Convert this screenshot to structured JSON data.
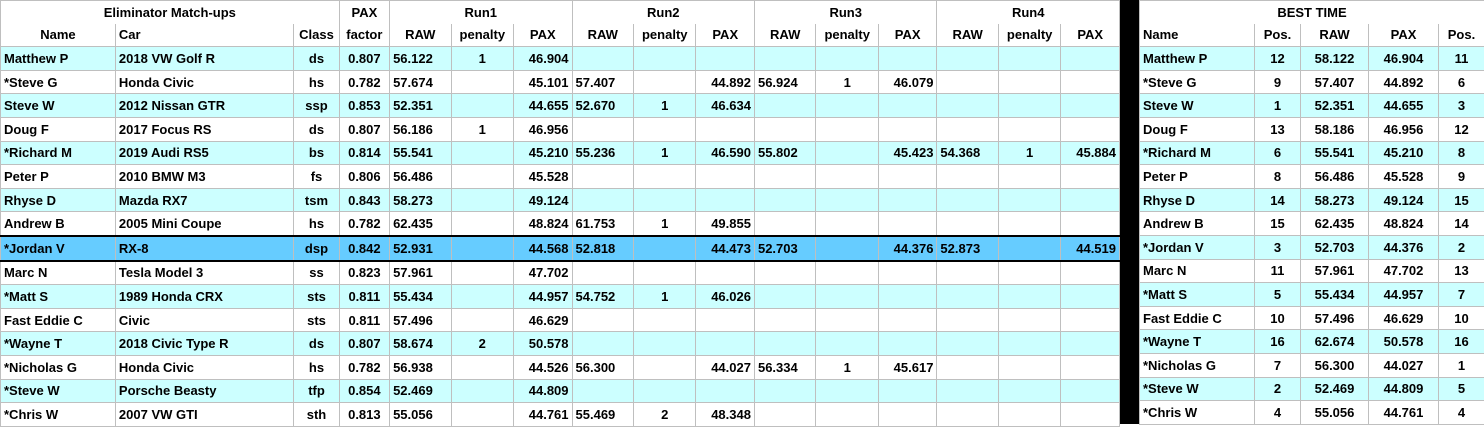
{
  "left": {
    "group_title": "Eliminator Match-ups",
    "pax_header": "PAX",
    "run_titles": [
      "Run1",
      "Run2",
      "Run3",
      "Run4"
    ],
    "col_headers": {
      "name": "Name",
      "car": "Car",
      "class": "Class",
      "factor": "factor",
      "raw": "RAW",
      "penalty": "penalty",
      "pax": "PAX"
    },
    "rows": [
      {
        "name": "Matthew P",
        "car": "2018 VW Golf R",
        "class": "ds",
        "factor": "0.807",
        "runs": [
          [
            "56.122",
            "1",
            "46.904"
          ],
          [
            "",
            "",
            ""
          ],
          [
            "",
            "",
            ""
          ],
          [
            "",
            "",
            ""
          ]
        ]
      },
      {
        "name": "*Steve G",
        "car": "Honda Civic",
        "class": "hs",
        "factor": "0.782",
        "runs": [
          [
            "57.674",
            "",
            "45.101"
          ],
          [
            "57.407",
            "",
            "44.892"
          ],
          [
            "56.924",
            "1",
            "46.079"
          ],
          [
            "",
            "",
            ""
          ]
        ]
      },
      {
        "name": "Steve W",
        "car": "2012 Nissan GTR",
        "class": "ssp",
        "factor": "0.853",
        "runs": [
          [
            "52.351",
            "",
            "44.655"
          ],
          [
            "52.670",
            "1",
            "46.634"
          ],
          [
            "",
            "",
            ""
          ],
          [
            "",
            "",
            ""
          ]
        ]
      },
      {
        "name": "Doug  F",
        "car": "2017 Focus RS",
        "class": "ds",
        "factor": "0.807",
        "runs": [
          [
            "56.186",
            "1",
            "46.956"
          ],
          [
            "",
            "",
            ""
          ],
          [
            "",
            "",
            ""
          ],
          [
            "",
            "",
            ""
          ]
        ]
      },
      {
        "name": "*Richard M",
        "car": "2019 Audi RS5",
        "class": "bs",
        "factor": "0.814",
        "runs": [
          [
            "55.541",
            "",
            "45.210"
          ],
          [
            "55.236",
            "1",
            "46.590"
          ],
          [
            "55.802",
            "",
            "45.423"
          ],
          [
            "54.368",
            "1",
            "45.884"
          ]
        ]
      },
      {
        "name": "Peter P",
        "car": "2010 BMW M3",
        "class": "fs",
        "factor": "0.806",
        "runs": [
          [
            "56.486",
            "",
            "45.528"
          ],
          [
            "",
            "",
            ""
          ],
          [
            "",
            "",
            ""
          ],
          [
            "",
            "",
            ""
          ]
        ]
      },
      {
        "name": "Rhyse D",
        "car": "Mazda RX7",
        "class": "tsm",
        "factor": "0.843",
        "runs": [
          [
            "58.273",
            "",
            "49.124"
          ],
          [
            "",
            "",
            ""
          ],
          [
            "",
            "",
            ""
          ],
          [
            "",
            "",
            ""
          ]
        ]
      },
      {
        "name": "Andrew B",
        "car": "2005 Mini Coupe",
        "class": "hs",
        "factor": "0.782",
        "runs": [
          [
            "62.435",
            "",
            "48.824"
          ],
          [
            "61.753",
            "1",
            "49.855"
          ],
          [
            "",
            "",
            ""
          ],
          [
            "",
            "",
            ""
          ]
        ]
      },
      {
        "name": "*Jordan V",
        "car": "RX-8",
        "class": "dsp",
        "factor": "0.842",
        "runs": [
          [
            "52.931",
            "",
            "44.568"
          ],
          [
            "52.818",
            "",
            "44.473"
          ],
          [
            "52.703",
            "",
            "44.376"
          ],
          [
            "52.873",
            "",
            "44.519"
          ]
        ]
      },
      {
        "name": "Marc N",
        "car": "Tesla Model 3",
        "class": "ss",
        "factor": "0.823",
        "runs": [
          [
            "57.961",
            "",
            "47.702"
          ],
          [
            "",
            "",
            ""
          ],
          [
            "",
            "",
            ""
          ],
          [
            "",
            "",
            ""
          ]
        ]
      },
      {
        "name": "*Matt S",
        "car": "1989 Honda CRX",
        "class": "sts",
        "factor": "0.811",
        "runs": [
          [
            "55.434",
            "",
            "44.957"
          ],
          [
            "54.752",
            "1",
            "46.026"
          ],
          [
            "",
            "",
            ""
          ],
          [
            "",
            "",
            ""
          ]
        ]
      },
      {
        "name": "Fast Eddie C",
        "car": "Civic",
        "class": "sts",
        "factor": "0.811",
        "runs": [
          [
            "57.496",
            "",
            "46.629"
          ],
          [
            "",
            "",
            ""
          ],
          [
            "",
            "",
            ""
          ],
          [
            "",
            "",
            ""
          ]
        ]
      },
      {
        "name": "*Wayne T",
        "car": "2018 Civic Type R",
        "class": "ds",
        "factor": "0.807",
        "runs": [
          [
            "58.674",
            "2",
            "50.578"
          ],
          [
            "",
            "",
            ""
          ],
          [
            "",
            "",
            ""
          ],
          [
            "",
            "",
            ""
          ]
        ]
      },
      {
        "name": "*Nicholas G",
        "car": "Honda Civic",
        "class": "hs",
        "factor": "0.782",
        "runs": [
          [
            "56.938",
            "",
            "44.526"
          ],
          [
            "56.300",
            "",
            "44.027"
          ],
          [
            "56.334",
            "1",
            "45.617"
          ],
          [
            "",
            "",
            ""
          ]
        ]
      },
      {
        "name": "*Steve W",
        "car": "Porsche Beasty",
        "class": "tfp",
        "factor": "0.854",
        "runs": [
          [
            "52.469",
            "",
            "44.809"
          ],
          [
            "",
            "",
            ""
          ],
          [
            "",
            "",
            ""
          ],
          [
            "",
            "",
            ""
          ]
        ]
      },
      {
        "name": "*Chris W",
        "car": "2007 VW GTI",
        "class": "sth",
        "factor": "0.813",
        "runs": [
          [
            "55.056",
            "",
            "44.761"
          ],
          [
            "55.469",
            "2",
            "48.348"
          ],
          [
            "",
            "",
            ""
          ],
          [
            "",
            "",
            ""
          ]
        ]
      }
    ]
  },
  "right": {
    "title": "BEST TIME",
    "col_headers": {
      "name": "Name",
      "pos1": "Pos.",
      "raw": "RAW",
      "pax": "PAX",
      "pos2": "Pos."
    },
    "rows": [
      {
        "name": "Matthew P",
        "pos1": "12",
        "raw": "58.122",
        "pax": "46.904",
        "pos2": "11"
      },
      {
        "name": "*Steve G",
        "pos1": "9",
        "raw": "57.407",
        "pax": "44.892",
        "pos2": "6"
      },
      {
        "name": "Steve W",
        "pos1": "1",
        "raw": "52.351",
        "pax": "44.655",
        "pos2": "3"
      },
      {
        "name": "Doug  F",
        "pos1": "13",
        "raw": "58.186",
        "pax": "46.956",
        "pos2": "12"
      },
      {
        "name": "*Richard M",
        "pos1": "6",
        "raw": "55.541",
        "pax": "45.210",
        "pos2": "8"
      },
      {
        "name": "Peter P",
        "pos1": "8",
        "raw": "56.486",
        "pax": "45.528",
        "pos2": "9"
      },
      {
        "name": "Rhyse D",
        "pos1": "14",
        "raw": "58.273",
        "pax": "49.124",
        "pos2": "15"
      },
      {
        "name": "Andrew B",
        "pos1": "15",
        "raw": "62.435",
        "pax": "48.824",
        "pos2": "14"
      },
      {
        "name": "*Jordan V",
        "pos1": "3",
        "raw": "52.703",
        "pax": "44.376",
        "pos2": "2"
      },
      {
        "name": "Marc N",
        "pos1": "11",
        "raw": "57.961",
        "pax": "47.702",
        "pos2": "13"
      },
      {
        "name": "*Matt S",
        "pos1": "5",
        "raw": "55.434",
        "pax": "44.957",
        "pos2": "7"
      },
      {
        "name": "Fast Eddie C",
        "pos1": "10",
        "raw": "57.496",
        "pax": "46.629",
        "pos2": "10"
      },
      {
        "name": "*Wayne T",
        "pos1": "16",
        "raw": "62.674",
        "pax": "50.578",
        "pos2": "16"
      },
      {
        "name": "*Nicholas G",
        "pos1": "7",
        "raw": "56.300",
        "pax": "44.027",
        "pos2": "1"
      },
      {
        "name": "*Steve W",
        "pos1": "2",
        "raw": "52.469",
        "pax": "44.809",
        "pos2": "5"
      },
      {
        "name": "*Chris W",
        "pos1": "4",
        "raw": "55.056",
        "pax": "44.761",
        "pos2": "4"
      }
    ]
  },
  "colors": {
    "cyan_row": "#ccffff",
    "selected_row": "#66ccff",
    "divider": "#000000"
  }
}
